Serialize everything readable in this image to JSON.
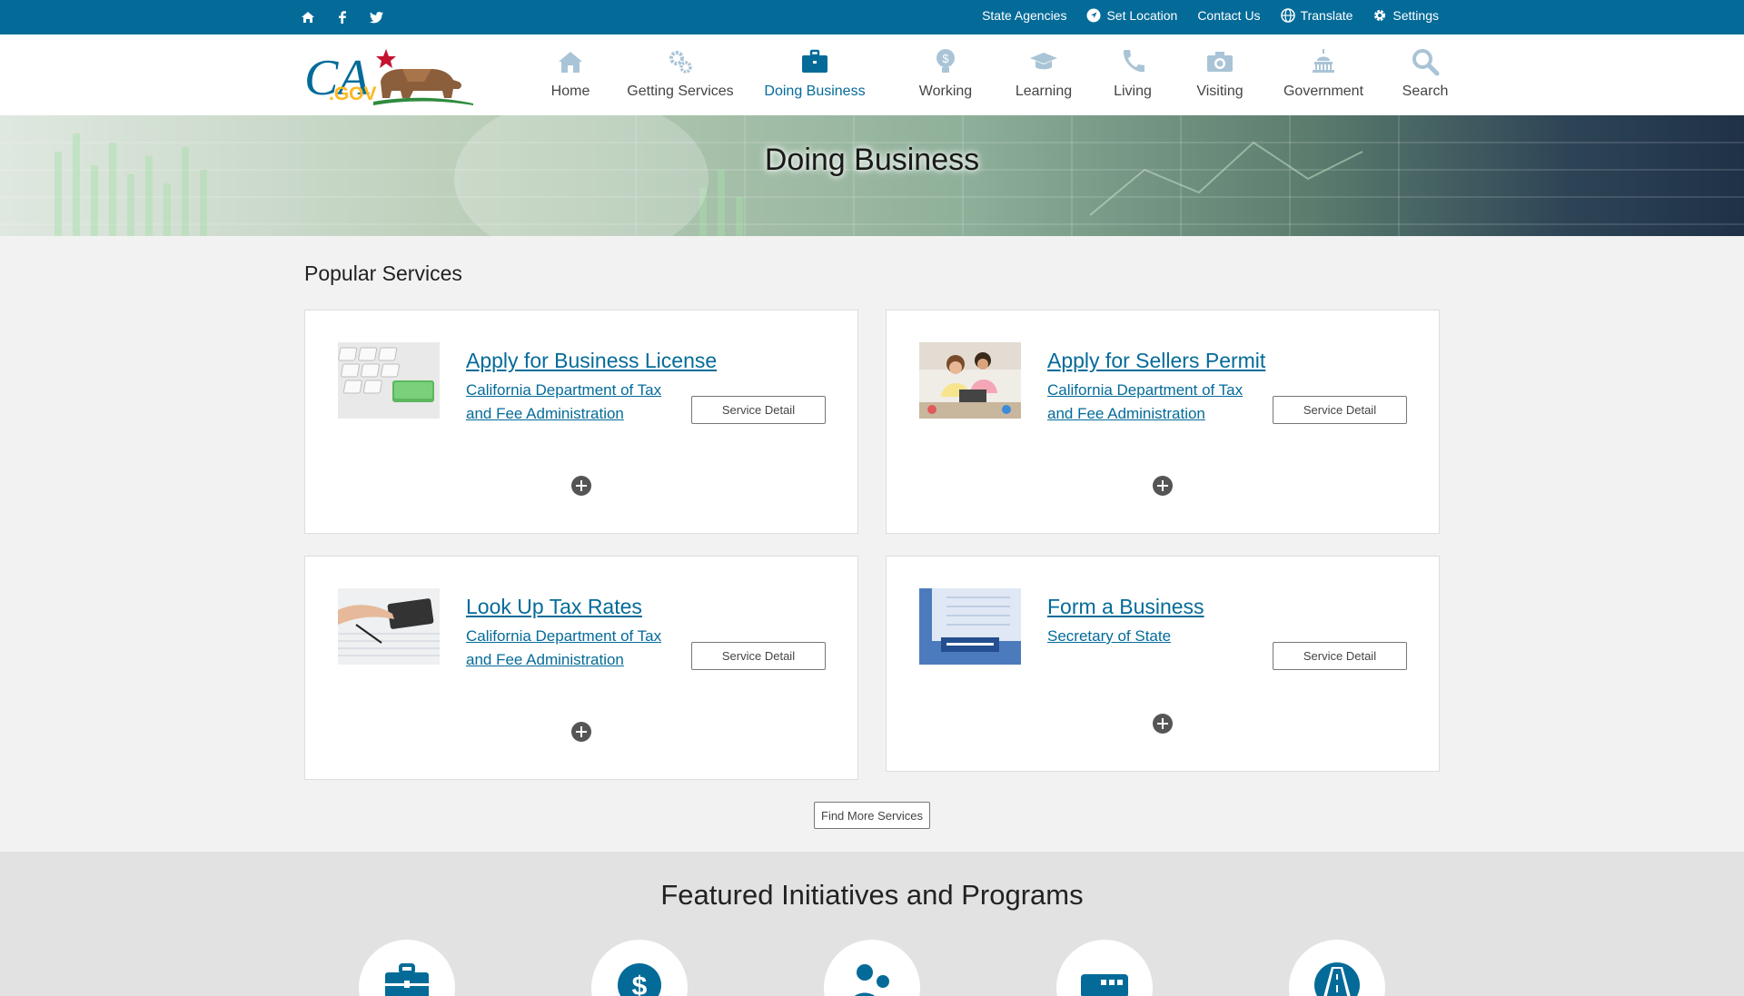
{
  "utility": {
    "links": [
      "State Agencies",
      "Set Location",
      "Contact Us",
      "Translate",
      "Settings"
    ],
    "icons": [
      "home-icon",
      "facebook-icon",
      "twitter-icon"
    ]
  },
  "nav": {
    "items": [
      {
        "label": "Home",
        "icon": "home-icon"
      },
      {
        "label": "Getting Services",
        "icon": "gears-icon"
      },
      {
        "label": "Doing Business",
        "icon": "briefcase-icon",
        "active": true
      },
      {
        "label": "Working",
        "icon": "lightbulb-dollar-icon"
      },
      {
        "label": "Learning",
        "icon": "graduation-cap-icon"
      },
      {
        "label": "Living",
        "icon": "phone-icon"
      },
      {
        "label": "Visiting",
        "icon": "camera-icon"
      },
      {
        "label": "Government",
        "icon": "capitol-icon"
      },
      {
        "label": "Search",
        "icon": "search-icon"
      }
    ]
  },
  "banner": {
    "title": "Doing Business"
  },
  "popular": {
    "title": "Popular Services",
    "cards": [
      {
        "title": "Apply for Business License",
        "agency": "California Department of Tax and Fee Administration",
        "button": "Service Detail"
      },
      {
        "title": "Apply for Sellers Permit",
        "agency": "California Department of Tax and Fee Administration",
        "button": "Service Detail"
      },
      {
        "title": "Look Up Tax Rates",
        "agency": "California Department of Tax and Fee Administration",
        "button": "Service Detail"
      },
      {
        "title": "Form a Business",
        "agency": "Secretary of State",
        "button": "Service Detail"
      }
    ],
    "find_more": "Find More Services"
  },
  "featured": {
    "title": "Featured Initiatives and Programs",
    "icons": [
      "briefcase-icon",
      "dollar-icon",
      "people-icon",
      "id-card-icon",
      "road-icon"
    ]
  },
  "colors": {
    "brand": "#046b99",
    "accent_gold": "#fdb81e"
  }
}
